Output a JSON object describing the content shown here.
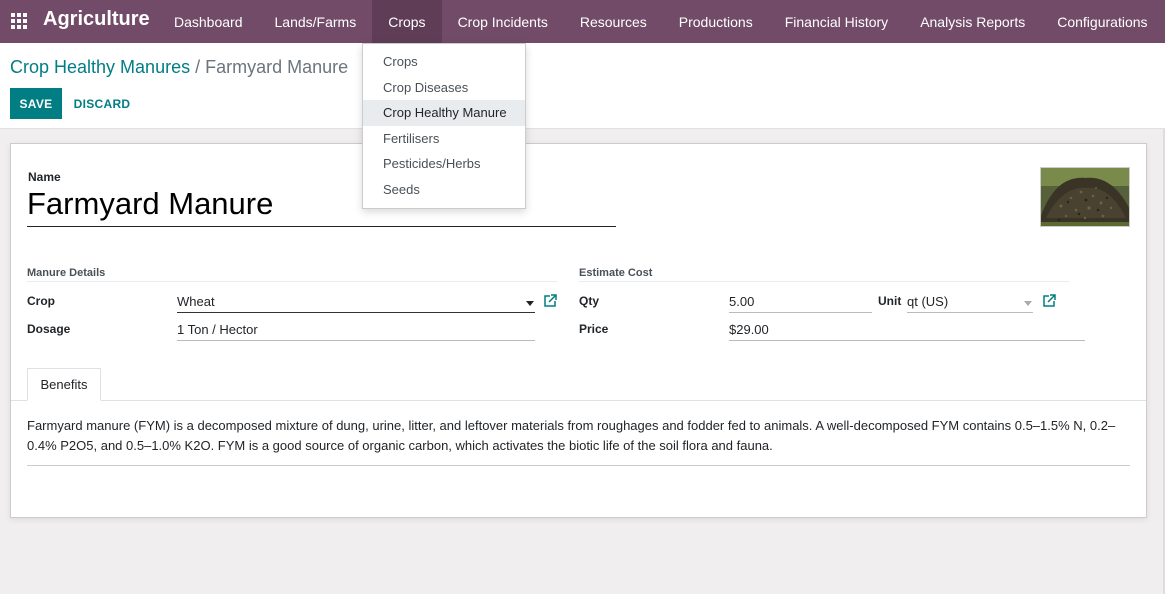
{
  "navbar": {
    "brand": "Agriculture",
    "menu": [
      "Dashboard",
      "Lands/Farms",
      "Crops",
      "Crop Incidents",
      "Resources",
      "Productions",
      "Financial History",
      "Analysis Reports",
      "Configurations"
    ],
    "active_menu": "Crops",
    "accent": "#714B67"
  },
  "breadcrumb": {
    "parent": "Crop Healthy Manures",
    "separator": "/",
    "current": "Farmyard Manure"
  },
  "buttons": {
    "save": "SAVE",
    "discard": "DISCARD"
  },
  "dropdown": {
    "items": [
      "Crops",
      "Crop Diseases",
      "Crop Healthy Manure",
      "Fertilisers",
      "Pesticides/Herbs",
      "Seeds"
    ],
    "active_item": "Crop Healthy Manure"
  },
  "form": {
    "name_label": "Name",
    "name_value": "Farmyard Manure",
    "manure_details_title": "Manure Details",
    "crop_label": "Crop",
    "crop_value": "Wheat",
    "dosage_label": "Dosage",
    "dosage_value": "1 Ton / Hector",
    "estimate_cost_title": "Estimate Cost",
    "qty_label": "Qty",
    "qty_value": "5.00",
    "unit_label": "Unit",
    "unit_value": "qt (US)",
    "price_label": "Price",
    "price_value": "$29.00"
  },
  "notebook": {
    "tab_label": "Benefits",
    "benefits_text": "Farmyard manure (FYM) is a decomposed mixture of dung, urine, litter, and leftover materials from roughages and fodder fed to animals. A well-decomposed FYM contains 0.5–1.5% N, 0.2–0.4% P2O5, and 0.5–1.0% K2O. FYM is a good source of organic carbon, which activates the biotic life of the soil flora and fauna."
  },
  "icons": {
    "apps": "apps-grid-icon",
    "external": "external-link-icon",
    "image": "manure-photo"
  },
  "colors": {
    "primary": "#017e84",
    "navbar": "#714B67"
  }
}
